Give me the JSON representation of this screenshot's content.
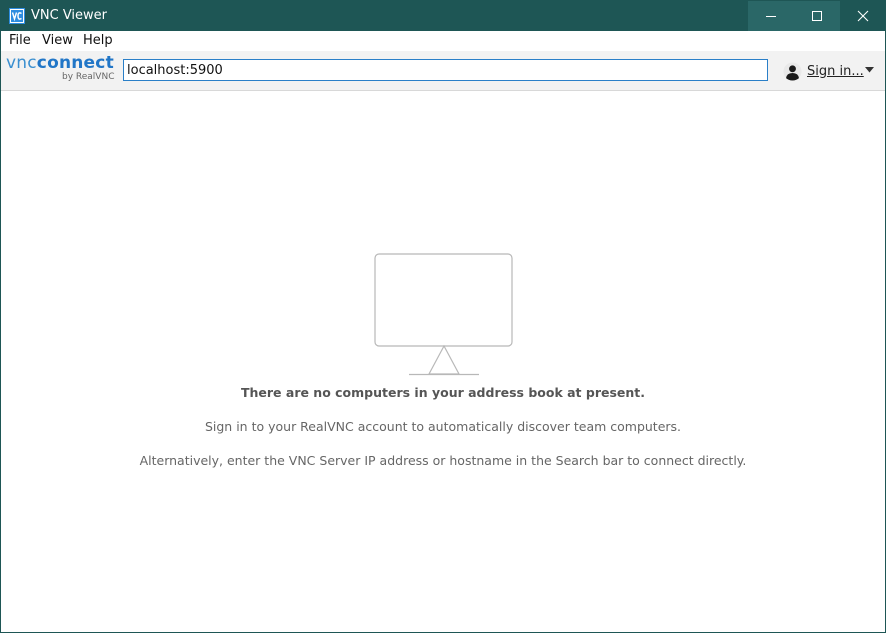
{
  "window": {
    "title": "VNC Viewer",
    "icon": "vnc-viewer-app-icon",
    "controls": [
      "minimize-icon",
      "maximize-icon",
      "close-icon"
    ]
  },
  "menu": {
    "items": [
      {
        "label": "File"
      },
      {
        "label": "View"
      },
      {
        "label": "Help"
      }
    ]
  },
  "toolbar": {
    "logo": {
      "brand_a": "vnc",
      "brand_b": "connect",
      "sub": "by RealVNC"
    },
    "search": {
      "value": "localhost:5900"
    },
    "signin": {
      "label": "Sign in...",
      "icon": "user-avatar-icon",
      "caret_icon": "chevron-down-icon"
    }
  },
  "empty_state": {
    "icon": "monitor-icon",
    "title": "There are no computers in your address book at present.",
    "line1": "Sign in to your RealVNC account to automatically discover team computers.",
    "line2": "Alternatively, enter the VNC Server IP address or hostname in the Search bar to connect directly."
  },
  "colors": {
    "titlebar": "#1e5655",
    "accent": "#2176c7",
    "input_border": "#2a7fc8"
  }
}
